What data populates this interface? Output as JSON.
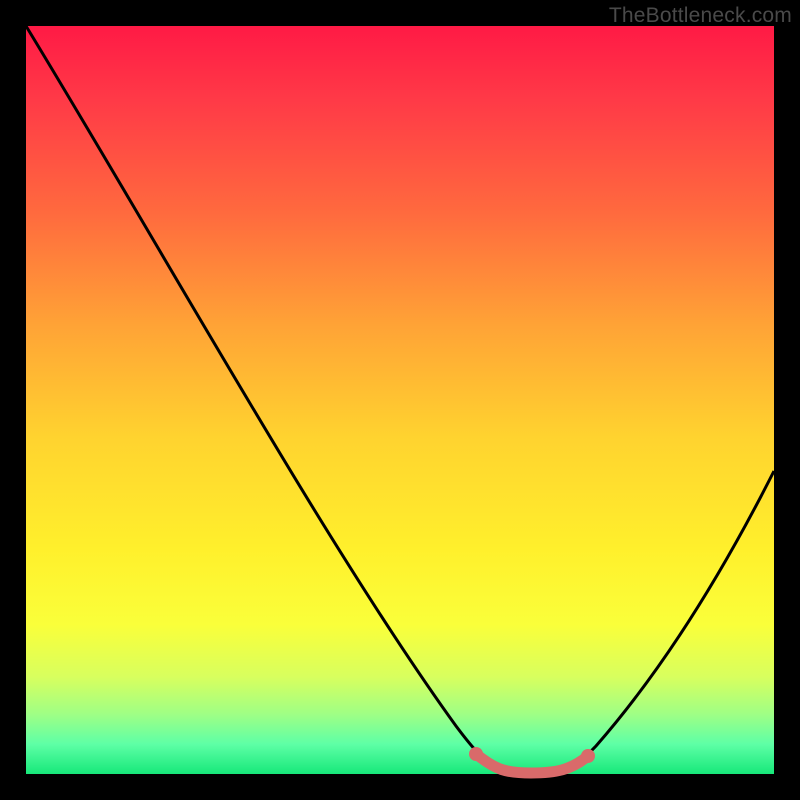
{
  "watermark": "TheBottleneck.com",
  "chart_data": {
    "type": "line",
    "title": "",
    "xlabel": "",
    "ylabel": "",
    "xlim": [
      0,
      100
    ],
    "ylim": [
      0,
      100
    ],
    "series": [
      {
        "name": "bottleneck-curve",
        "x": [
          0,
          10,
          20,
          30,
          40,
          50,
          58,
          62,
          66,
          70,
          74,
          80,
          90,
          100
        ],
        "y": [
          100,
          85,
          70,
          55,
          40,
          25,
          10,
          3,
          0,
          0,
          3,
          12,
          27,
          42
        ]
      }
    ],
    "highlight": {
      "name": "optimal-range",
      "x_range": [
        61,
        75
      ],
      "y": 0
    },
    "background_gradient": {
      "top_color": "#ff1a45",
      "mid_color": "#fff02c",
      "bottom_color": "#17e87a"
    }
  }
}
